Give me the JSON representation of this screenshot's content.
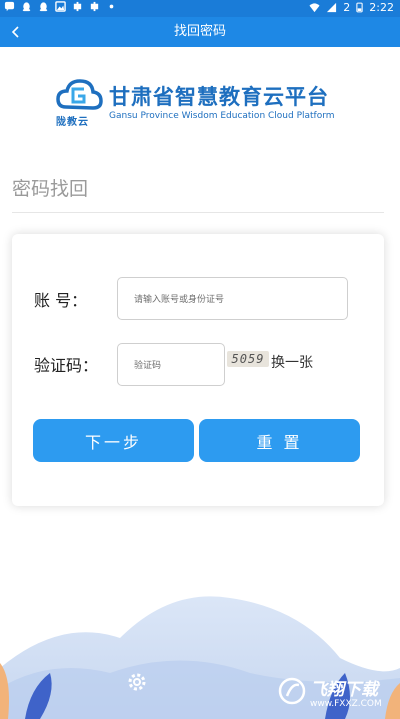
{
  "status_bar": {
    "left_icons": [
      "chat-bubble-icon",
      "qq-icon",
      "qq-icon",
      "gallery-icon",
      "bug-icon",
      "bug-icon",
      "dot-icon"
    ],
    "battery_level": "2",
    "time": "2:22"
  },
  "app_bar": {
    "title": "找回密码"
  },
  "logo": {
    "mark_text": "陇教云",
    "cn_name": "甘肃省智慧教育云平台",
    "en_name": "Gansu Province Wisdom Education Cloud Platform"
  },
  "section": {
    "title": "密码找回"
  },
  "form": {
    "account_label": "账 号：",
    "account_placeholder": "请输入账号或身份证号",
    "captcha_label": "验证码：",
    "captcha_placeholder": "验证码",
    "captcha_image_text": "5059",
    "refresh_label": "换一张",
    "next_label": "下一步",
    "reset_label": "重 置"
  },
  "watermark": {
    "text": "飞翔下载",
    "url": "www.FXXZ.COM"
  },
  "colors": {
    "status_bar": "#1a7cd8",
    "app_bar": "#1e88e5",
    "brand_blue": "#1e6fbf",
    "button": "#2d9bf0"
  }
}
